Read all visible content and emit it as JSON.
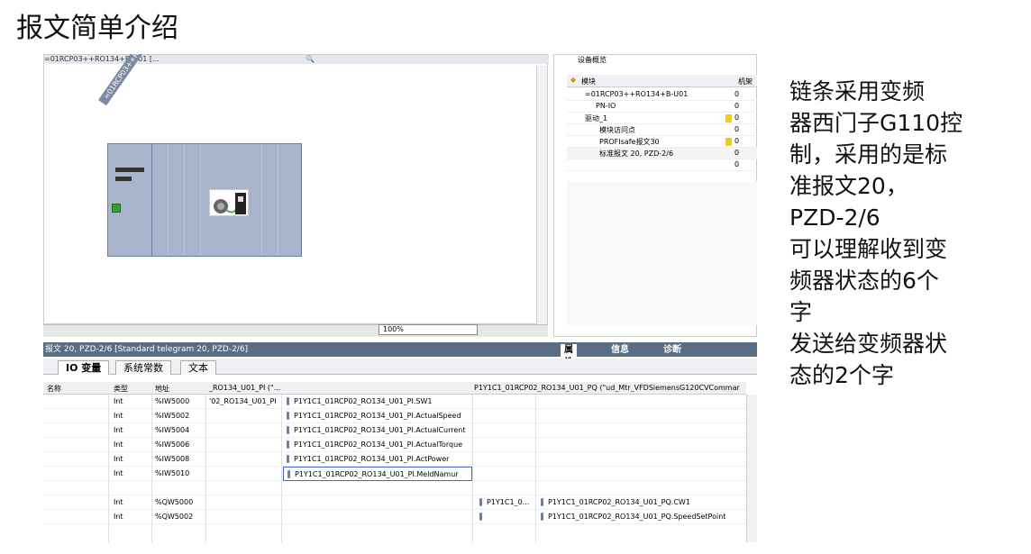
{
  "slide_title": "报文简单介绍",
  "device_view": {
    "toolbar_text": "=01RCP03++RO134+B-U01 [...",
    "rack_label": "=01RCP03++RO13...",
    "zoom_value": "100%"
  },
  "device_overview": {
    "tab_label": "设备概览",
    "header": {
      "module": "模块",
      "rack": "机架"
    },
    "rows": [
      {
        "name": "=01RCP03++RO134+B-U01",
        "rack": "0"
      },
      {
        "name": "PN-IO",
        "rack": "0"
      },
      {
        "name": "驱动_1",
        "rack": "0"
      },
      {
        "name": "模块访问点",
        "rack": "0"
      },
      {
        "name": "PROFIsafe报文30",
        "rack": "0"
      },
      {
        "name": "标准报文 20, PZD-2/6",
        "rack": "0"
      },
      {
        "name": "",
        "rack": "0"
      }
    ]
  },
  "properties": {
    "title": "报文 20, PZD-2/6 [Standard telegram 20, PZD-2/6]",
    "tabs": [
      "属性",
      "信息",
      "诊断"
    ],
    "sub_tabs": [
      "IO 变量",
      "系统常数",
      "文本"
    ],
    "columns": [
      "名称",
      "类型",
      "地址",
      "_RO134_U01_PI (\"...",
      "P1Y1C1_01RCP02_RO134_U01_PQ (\"ud_Mtr_VFDSiemensG120CVCommar"
    ],
    "rows": [
      {
        "type": "Int",
        "address": "%IW5000",
        "col_a": "'02_RO134_U01_PI",
        "var": "P1Y1C1_01RCP02_RO134_U01_PI.SW1",
        "col_b": "",
        "var_b": ""
      },
      {
        "type": "Int",
        "address": "%IW5002",
        "col_a": "",
        "var": "P1Y1C1_01RCP02_RO134_U01_PI.ActualSpeed",
        "col_b": "",
        "var_b": ""
      },
      {
        "type": "Int",
        "address": "%IW5004",
        "col_a": "",
        "var": "P1Y1C1_01RCP02_RO134_U01_PI.ActualCurrent",
        "col_b": "",
        "var_b": ""
      },
      {
        "type": "Int",
        "address": "%IW5006",
        "col_a": "",
        "var": "P1Y1C1_01RCP02_RO134_U01_PI.ActualTorque",
        "col_b": "",
        "var_b": ""
      },
      {
        "type": "Int",
        "address": "%IW5008",
        "col_a": "",
        "var": "P1Y1C1_01RCP02_RO134_U01_PI.ActPower",
        "col_b": "",
        "var_b": ""
      },
      {
        "type": "Int",
        "address": "%IW5010",
        "col_a": "",
        "var": "P1Y1C1_01RCP02_RO134_U01_PI.MeldNamur",
        "col_b": "",
        "var_b": ""
      },
      {
        "type": "",
        "address": "",
        "col_a": "",
        "var": "",
        "col_b": "",
        "var_b": ""
      },
      {
        "type": "Int",
        "address": "%QW5000",
        "col_a": "",
        "var": "",
        "col_b": "P1Y1C1_0...",
        "var_b": "P1Y1C1_01RCP02_RO134_U01_PQ.CW1"
      },
      {
        "type": "Int",
        "address": "%QW5002",
        "col_a": "",
        "var": "",
        "col_b": "",
        "var_b": "P1Y1C1_01RCP02_RO134_U01_PQ.SpeedSetPoint"
      }
    ]
  },
  "description": [
    "  链条采用变频",
    "器西门子G110控",
    "制，采用的是标",
    "准报文20，",
    "PZD-2/6",
    "可以理解收到变",
    "频器状态的6个",
    "字",
    "发送给变频器状",
    "态的2个字"
  ]
}
